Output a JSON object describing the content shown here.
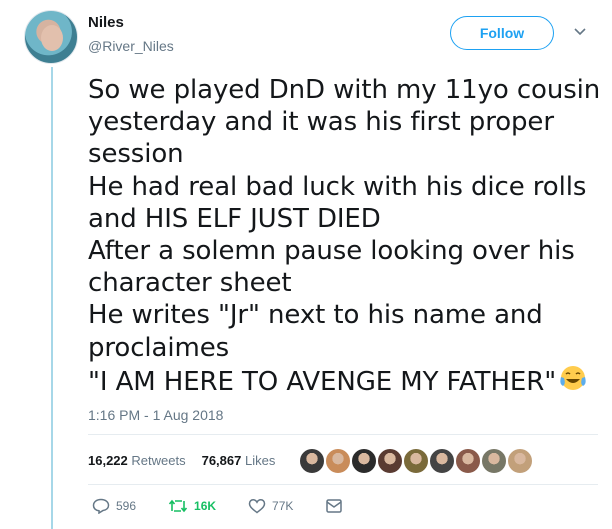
{
  "author": {
    "display_name": "Niles",
    "handle": "@River_Niles",
    "avatar_icon": "user-avatar"
  },
  "follow": {
    "label": "Follow",
    "color": "#1da1f2"
  },
  "tweet": {
    "lines": [
      "So we played DnD with my 11yo cousin",
      "yesterday and it was his first proper",
      "session",
      "He had real bad luck with his dice rolls",
      "and HIS ELF JUST DIED",
      "After a solemn pause looking over his",
      "character sheet",
      "He writes \"Jr\" next to his name and",
      "proclaimes",
      "\"I AM HERE TO AVENGE MY FATHER\""
    ],
    "emoji_icon": "tears-of-joy-emoji",
    "timestamp": "1:16 PM - 1 Aug 2018"
  },
  "stats": {
    "retweets_count": "16,222",
    "retweets_label": "Retweets",
    "likes_count": "76,867",
    "likes_label": "Likes",
    "liker_avatars": [
      "#3a3a3a",
      "#c98c5a",
      "#2b2b2b",
      "#5a3b32",
      "#7a6a3a",
      "#444444",
      "#8a5a4a",
      "#777766",
      "#c2a07a"
    ]
  },
  "actions": {
    "reply_count": "596",
    "retweet_count": "16K",
    "like_count": "77K",
    "retweet_color": "#17bf63",
    "icons": [
      "reply-icon",
      "retweet-icon",
      "like-icon",
      "message-icon"
    ]
  }
}
